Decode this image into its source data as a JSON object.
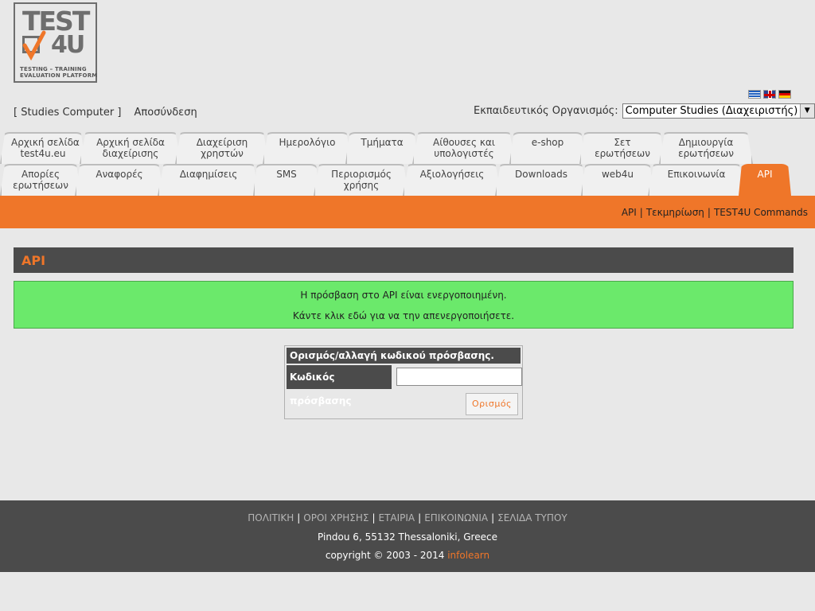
{
  "logo": {
    "title": "TEST",
    "suffix": "4U",
    "tagline_1": "TESTING  –  TRAINING",
    "tagline_2": "EVALUATION PLATFORM"
  },
  "user": {
    "account_label": "[ Studies Computer ]",
    "logout_label": "Αποσύνδεση"
  },
  "languages": [
    "gr-flag",
    "uk-flag",
    "de-flag"
  ],
  "organization": {
    "label": "Εκπαιδευτικός Οργανισμός:",
    "selected": "Computer Studies (Διαχειριστής)"
  },
  "tabs_row1": [
    {
      "l1": "Αρχική σελίδα",
      "l2": "test4u.eu"
    },
    {
      "l1": "Αρχική σελίδα",
      "l2": "διαχείρισης"
    },
    {
      "l1": "Διαχείριση",
      "l2": "χρηστών"
    },
    {
      "l1": "Ημερολόγιο",
      "l2": ""
    },
    {
      "l1": "Τμήματα",
      "l2": ""
    },
    {
      "l1": "Αίθουσες και",
      "l2": "υπολογιστές"
    },
    {
      "l1": "e-shop",
      "l2": ""
    },
    {
      "l1": "Σετ",
      "l2": "ερωτήσεων"
    },
    {
      "l1": "Δημιουργία",
      "l2": "ερωτήσεων"
    }
  ],
  "tabs_row2": [
    {
      "l1": "Απορίες",
      "l2": "ερωτήσεων"
    },
    {
      "l1": "Αναφορές",
      "l2": ""
    },
    {
      "l1": "Διαφημίσεις",
      "l2": ""
    },
    {
      "l1": "SMS",
      "l2": ""
    },
    {
      "l1": "Περιορισμός",
      "l2": "χρήσης"
    },
    {
      "l1": "Αξιολογήσεις",
      "l2": ""
    },
    {
      "l1": "Downloads",
      "l2": ""
    },
    {
      "l1": "web4u",
      "l2": ""
    },
    {
      "l1": "Επικοινωνία",
      "l2": ""
    },
    {
      "l1": "API",
      "l2": "",
      "active": true
    }
  ],
  "sublinks": {
    "api": "API",
    "docs": "Τεκμηρίωση",
    "commands": "TEST4U Commands",
    "sep": "|"
  },
  "section": {
    "title": "API"
  },
  "notice": {
    "line1": "Η πρόσβαση στο API είναι ενεργοποιημένη.",
    "line2": "Κάντε κλικ εδώ για να την απενεργοποιήσετε."
  },
  "password_form": {
    "title": "Ορισμός/αλλαγή κωδικού πρόσβασης.",
    "label": "Κωδικός πρόσβασης",
    "value": "",
    "button": "Ορισμός"
  },
  "footer": {
    "links": [
      "ΠΟΛΙΤΙΚΗ",
      "ΟΡΟΙ ΧΡΗΣΗΣ",
      "ΕΤΑΙΡΙΑ",
      "ΕΠΙΚΟΙΝΩΝΙΑ",
      "ΣΕΛΙΔΑ ΤΥΠΟΥ"
    ],
    "sep": "|",
    "address": "Pindou 6, 55132 Thessaloniki, Greece",
    "copyright": "copyright © 2003 - 2014",
    "brand": "infolearn"
  },
  "colors": {
    "accent": "#ef7629",
    "dark": "#4b4b4b",
    "success": "#6be96b",
    "background": "#e8e8e8"
  }
}
